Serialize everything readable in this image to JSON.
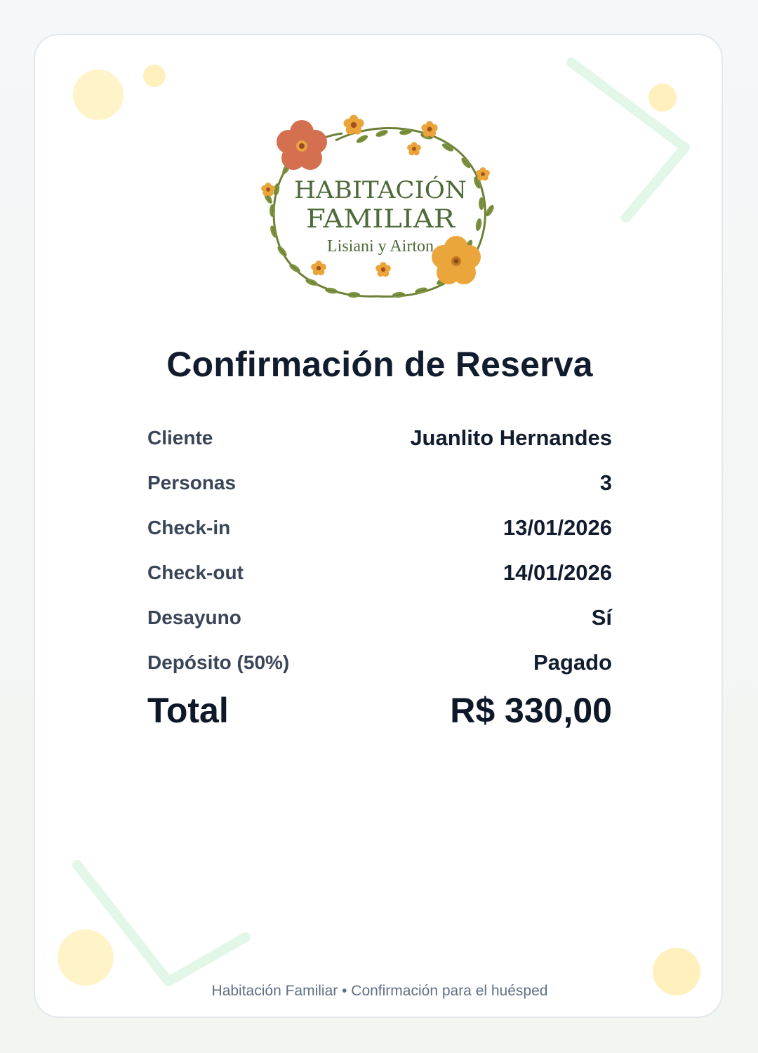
{
  "logo": {
    "line1": "HABITACIÓN",
    "line2": "FAMILIAR",
    "line3": "Lisiani y Airton"
  },
  "title": "Confirmación de Reserva",
  "details": [
    {
      "label": "Cliente",
      "value": "Juanlito Hernandes"
    },
    {
      "label": "Personas",
      "value": "3"
    },
    {
      "label": "Check-in",
      "value": "13/01/2026"
    },
    {
      "label": "Check-out",
      "value": "14/01/2026"
    },
    {
      "label": "Desayuno",
      "value": "Sí"
    },
    {
      "label": "Depósito (50%)",
      "value": "Pagado"
    }
  ],
  "total": {
    "label": "Total",
    "value": "R$ 330,00"
  },
  "footer": "Habitación Familiar • Confirmación para el huésped",
  "colors": {
    "text_dark": "#111c2e",
    "label": "#3a4558",
    "accent_green": "#556b3c",
    "flower_coral": "#d4704f",
    "flower_gold": "#e6a23c",
    "deco_yellow": "#fff3c9",
    "deco_mint": "#e2f7e8"
  }
}
